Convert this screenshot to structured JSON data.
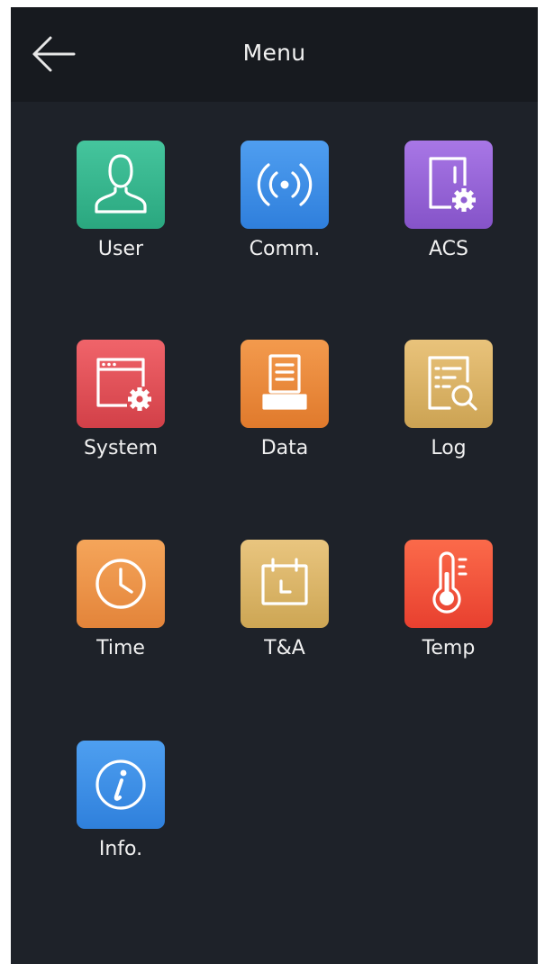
{
  "header": {
    "title": "Menu",
    "back_icon": "arrow-left-icon"
  },
  "colors": {
    "background": "#1e2229",
    "header": "#171a1f",
    "text": "#f0f0f0"
  },
  "menu": {
    "items": [
      {
        "label": "User",
        "icon": "user-icon",
        "color": "#2fae86"
      },
      {
        "label": "Comm.",
        "icon": "wireless-signal-icon",
        "color": "#3a8ee6"
      },
      {
        "label": "ACS",
        "icon": "door-gear-icon",
        "color": "#9160d4"
      },
      {
        "label": "System",
        "icon": "window-gear-icon",
        "color": "#dd4c53"
      },
      {
        "label": "Data",
        "icon": "database-document-icon",
        "color": "#e8863a"
      },
      {
        "label": "Log",
        "icon": "document-search-icon",
        "color": "#d6b065"
      },
      {
        "label": "Time",
        "icon": "clock-icon",
        "color": "#ea9149"
      },
      {
        "label": "T&A",
        "icon": "calendar-icon",
        "color": "#d6b267"
      },
      {
        "label": "Temp",
        "icon": "thermometer-icon",
        "color": "#f0503a"
      },
      {
        "label": "Info.",
        "icon": "info-icon",
        "color": "#3a8ee6"
      }
    ]
  }
}
